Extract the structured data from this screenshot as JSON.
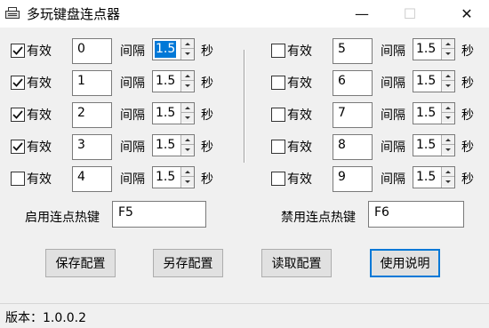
{
  "window": {
    "title": "多玩键盘连点器",
    "controls": {
      "minimize": "—",
      "maximize": "☐",
      "close": "✕"
    }
  },
  "left_rows": [
    {
      "checked": true,
      "check_label": "有效",
      "key": "0",
      "interval_label": "间隔",
      "interval": "1.5",
      "unit": "秒",
      "selected": true
    },
    {
      "checked": true,
      "check_label": "有效",
      "key": "1",
      "interval_label": "间隔",
      "interval": "1.5",
      "unit": "秒"
    },
    {
      "checked": true,
      "check_label": "有效",
      "key": "2",
      "interval_label": "间隔",
      "interval": "1.5",
      "unit": "秒"
    },
    {
      "checked": true,
      "check_label": "有效",
      "key": "3",
      "interval_label": "间隔",
      "interval": "1.5",
      "unit": "秒"
    },
    {
      "checked": false,
      "check_label": "有效",
      "key": "4",
      "interval_label": "间隔",
      "interval": "1.5",
      "unit": "秒"
    }
  ],
  "right_rows": [
    {
      "checked": false,
      "check_label": "有效",
      "key": "5",
      "interval_label": "间隔",
      "interval": "1.5",
      "unit": "秒"
    },
    {
      "checked": false,
      "check_label": "有效",
      "key": "6",
      "interval_label": "间隔",
      "interval": "1.5",
      "unit": "秒"
    },
    {
      "checked": false,
      "check_label": "有效",
      "key": "7",
      "interval_label": "间隔",
      "interval": "1.5",
      "unit": "秒"
    },
    {
      "checked": false,
      "check_label": "有效",
      "key": "8",
      "interval_label": "间隔",
      "interval": "1.5",
      "unit": "秒"
    },
    {
      "checked": false,
      "check_label": "有效",
      "key": "9",
      "interval_label": "间隔",
      "interval": "1.5",
      "unit": "秒"
    }
  ],
  "hotkeys": {
    "enable_label": "启用连点热键",
    "enable_value": "F5",
    "disable_label": "禁用连点热键",
    "disable_value": "F6"
  },
  "buttons": {
    "save": "保存配置",
    "save_as": "另存配置",
    "load": "读取配置",
    "help": "使用说明"
  },
  "status": {
    "version": "版本：1.0.0.2"
  }
}
